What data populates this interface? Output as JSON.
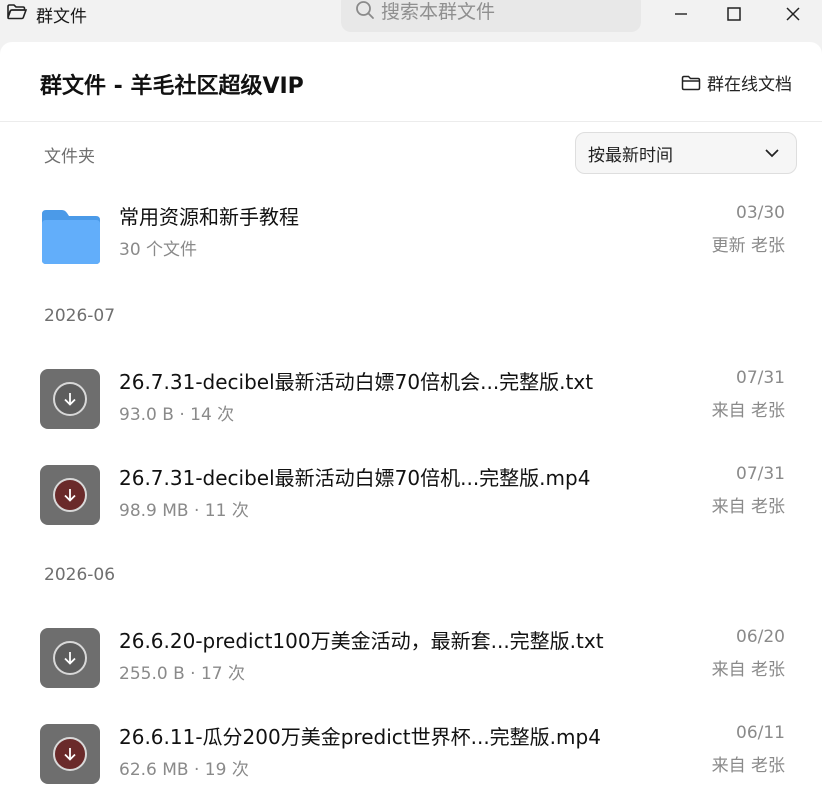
{
  "window": {
    "app_title": "群文件",
    "search_placeholder": "搜索本群文件"
  },
  "header": {
    "title": "群文件 - 羊毛社区超级VIP",
    "online_docs_label": "群在线文档"
  },
  "folders_label": "文件夹",
  "sort": {
    "selected": "按最新时间"
  },
  "folder": {
    "name": "常用资源和新手教程",
    "count": "30 个文件",
    "date": "03/30",
    "by": "更新 老张",
    "color": "#5aa9f5"
  },
  "sections": [
    {
      "label": "2026-07",
      "files": [
        {
          "name": "26.7.31-decibel最新活动白嫖70倍机会...完整版.txt",
          "meta": "93.0 B · 14 次",
          "date": "07/31",
          "by": "来自 老张",
          "type": "txt"
        },
        {
          "name": "26.7.31-decibel最新活动白嫖70倍机...完整版.mp4",
          "meta": "98.9 MB · 11 次",
          "date": "07/31",
          "by": "来自 老张",
          "type": "mp4"
        }
      ]
    },
    {
      "label": "2026-06",
      "files": [
        {
          "name": "26.6.20-predict100万美金活动，最新套...完整版.txt",
          "meta": "255.0 B · 17 次",
          "date": "06/20",
          "by": "来自 老张",
          "type": "txt"
        },
        {
          "name": "26.6.11-瓜分200万美金predict世界杯...完整版.mp4",
          "meta": "62.6 MB · 19 次",
          "date": "06/11",
          "by": "来自 老张",
          "type": "mp4"
        }
      ]
    }
  ]
}
